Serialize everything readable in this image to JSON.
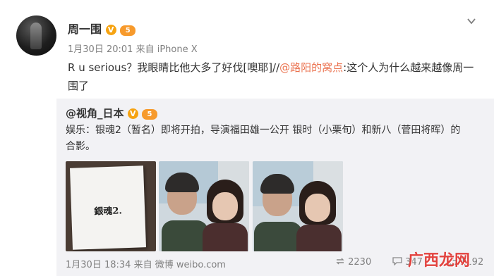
{
  "post": {
    "author": "周一围",
    "verified_badge": "V",
    "level_badge": "5",
    "time": "1月30日 20:01",
    "source_prefix": "来自",
    "source": "iPhone X",
    "text_part1": "R u serious？我眼睛比他大多了好伐[噢耶]//",
    "mention": "@路阳的窝点",
    "text_part2": ":这个人为什么越来越像周一围了"
  },
  "repost": {
    "author": "@视角_日本",
    "verified_badge": "V",
    "level_badge": "5",
    "text": "娱乐：银魂2（暂名）即将开拍，导演福田雄一公开 银时（小栗旬）和新八（菅田将晖）的合影。",
    "image1_caption": "銀魂2.",
    "time": "1月30日 18:34",
    "source_prefix": "来自",
    "source": "微博 weibo.com",
    "repost_count": "2230",
    "comment_count": "347",
    "like_count": "1192"
  },
  "watermark": "广西龙网",
  "colors": {
    "mention": "#eb7350",
    "verified": "#f6a311",
    "repost_bg": "#f2f2f5"
  },
  "icons": [
    "chevron-down-icon",
    "repost-icon",
    "comment-icon",
    "like-icon"
  ]
}
